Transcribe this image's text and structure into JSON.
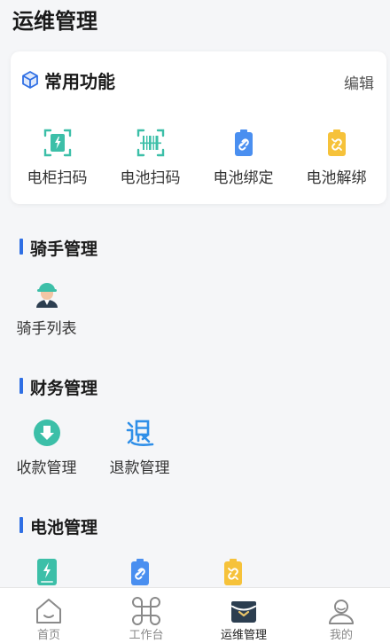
{
  "page": {
    "title": "运维管理"
  },
  "common": {
    "title": "常用功能",
    "edit_label": "编辑",
    "items": [
      {
        "label": "电柜扫码",
        "icon": "cabinet-scan-icon"
      },
      {
        "label": "电池扫码",
        "icon": "barcode-scan-icon"
      },
      {
        "label": "电池绑定",
        "icon": "battery-bind-icon"
      },
      {
        "label": "电池解绑",
        "icon": "battery-unbind-icon"
      }
    ]
  },
  "sections": [
    {
      "title": "骑手管理",
      "items": [
        {
          "label": "骑手列表",
          "icon": "rider-icon"
        }
      ]
    },
    {
      "title": "财务管理",
      "items": [
        {
          "label": "收款管理",
          "icon": "collect-icon"
        },
        {
          "label": "退款管理",
          "icon": "refund-icon"
        }
      ]
    },
    {
      "title": "电池管理",
      "items": [
        {
          "icon": "battery-charge-icon"
        },
        {
          "icon": "battery-link-icon"
        },
        {
          "icon": "battery-unlink-icon"
        }
      ]
    }
  ],
  "tabbar": {
    "items": [
      {
        "label": "首页",
        "icon": "home-icon",
        "active": false
      },
      {
        "label": "工作台",
        "icon": "command-icon",
        "active": false
      },
      {
        "label": "运维管理",
        "icon": "wallet-icon",
        "active": true
      },
      {
        "label": "我的",
        "icon": "user-icon",
        "active": false
      }
    ]
  },
  "colors": {
    "accent": "#2f6fe4",
    "teal": "#3cbfa8",
    "blue": "#4a8ff0",
    "yellow": "#f6c23a"
  }
}
